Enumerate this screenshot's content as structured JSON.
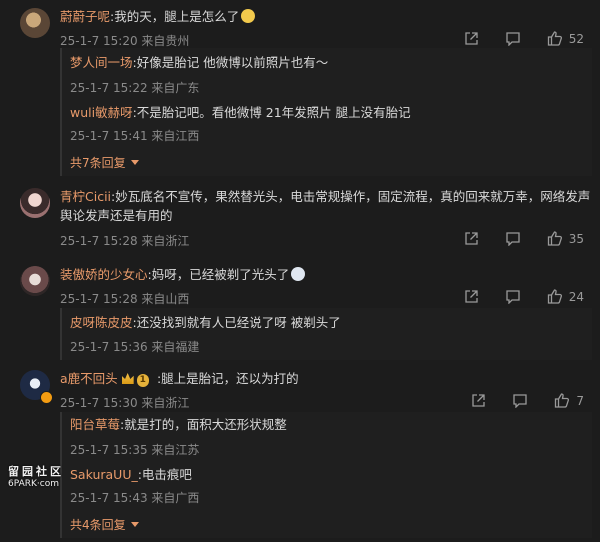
{
  "comments": [
    {
      "name": "蔚蔚子呢",
      "text": ":我的天，腿上是怎么了",
      "meta": "25-1-7 15:20 来自贵州",
      "likes": "52",
      "replies": [
        {
          "name": "梦人间一场",
          "text": ":好像是胎记 他微博以前照片也有～",
          "meta": "25-1-7 15:22 来自广东"
        },
        {
          "name": "wuli敏赫呀",
          "text": ":不是胎记吧。看他微博 21年发照片 腿上没有胎记",
          "meta": "25-1-7 15:41 来自江西"
        }
      ],
      "more": "共7条回复"
    },
    {
      "name": "青柠Cicii",
      "text_line1": ":妙瓦底名不宣传，果然替光头，电击常规操作，固定流程，真的回来就万幸，网络发声",
      "text_line2": "舆论发声还是有用的",
      "meta": "25-1-7 15:28 来自浙江",
      "likes": "35"
    },
    {
      "name": "装傲娇的少女心",
      "text": ":妈呀，已经被剃了光头了",
      "meta": "25-1-7 15:28 来自山西",
      "likes": "24",
      "replies": [
        {
          "name": "皮呀陈皮皮",
          "text": ":还没找到就有人已经说了呀 被剃头了",
          "meta": "25-1-7 15:36 来自福建"
        }
      ]
    },
    {
      "name": "a鹿不回头",
      "vip": "1",
      "text": ":腿上是胎记，还以为打的",
      "meta": "25-1-7 15:30 来自浙江",
      "likes": "7",
      "replies": [
        {
          "name": "阳台草莓",
          "text": ":就是打的，面积大还形状规整",
          "meta": "25-1-7 15:35 来自江苏"
        },
        {
          "name": "SakuraUU_",
          "text": ":电击痕吧",
          "meta": "25-1-7 15:43 来自广西"
        }
      ],
      "more": "共4条回复"
    }
  ],
  "watermark": {
    "line1": "留园社区",
    "line2": "6PARK·com"
  },
  "colors": {
    "accent": "#e89a6a",
    "background": "#1c1c1c",
    "meta": "#8a8a8a"
  },
  "icons": [
    "share-icon",
    "comment-icon",
    "like-icon",
    "chevron-down-icon"
  ]
}
